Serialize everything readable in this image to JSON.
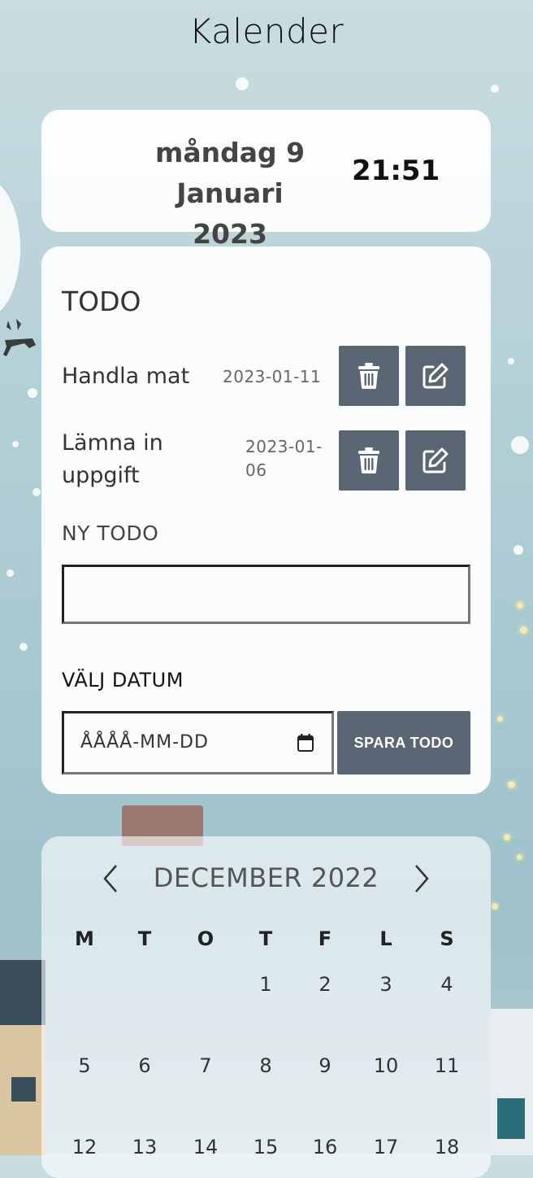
{
  "app_title": "Kalender",
  "date_card": {
    "weekday_day": "måndag 9",
    "month_year": "Januari 2023",
    "time": "21:51"
  },
  "todo": {
    "heading": "TODO",
    "items": [
      {
        "text_line1": "Handla mat",
        "text_line2": "",
        "date_line1": "2023-01-11",
        "date_line2": ""
      },
      {
        "text_line1": "Lämna in",
        "text_line2": "uppgift",
        "date_line1": "2023-01-",
        "date_line2": "06"
      }
    ],
    "new_todo_label": "NY TODO",
    "new_todo_value": "",
    "date_label": "VÄLJ DATUM",
    "date_placeholder": "ÅÅÅÅ-MM-DD",
    "save_label": "SPARA TODO",
    "delete_icon": "trash-icon",
    "edit_icon": "edit-icon"
  },
  "calendar": {
    "month_label": "DECEMBER 2022",
    "prev_icon": "chevron-left-icon",
    "next_icon": "chevron-right-icon",
    "weekdays": [
      "M",
      "T",
      "O",
      "T",
      "F",
      "L",
      "S"
    ],
    "weeks": [
      [
        "",
        "",
        "",
        "1",
        "2",
        "3",
        "4"
      ],
      [
        "5",
        "6",
        "7",
        "8",
        "9",
        "10",
        "11"
      ],
      [
        "12",
        "13",
        "14",
        "15",
        "16",
        "17",
        "18"
      ]
    ]
  },
  "colors": {
    "button_bg": "#5a6673",
    "card_bg": "#ffffff",
    "background": "#b9d3d9"
  }
}
